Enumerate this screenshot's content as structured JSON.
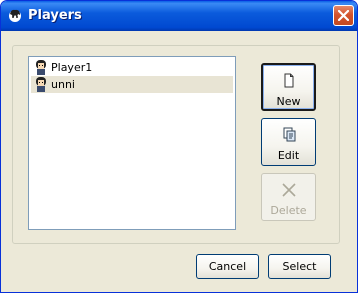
{
  "window": {
    "title": "Players"
  },
  "players": [
    {
      "name": "Player1",
      "selected": false
    },
    {
      "name": "unni",
      "selected": true
    }
  ],
  "side_buttons": {
    "new_label": "New",
    "edit_label": "Edit",
    "delete_label": "Delete"
  },
  "footer": {
    "cancel_label": "Cancel",
    "select_label": "Select"
  },
  "colors": {
    "title_bar": "#0b5bdc",
    "window_bg": "#ece9d8",
    "list_border": "#7f9db9",
    "selection_bg": "#e8e4d4",
    "disabled_text": "#aca899"
  }
}
